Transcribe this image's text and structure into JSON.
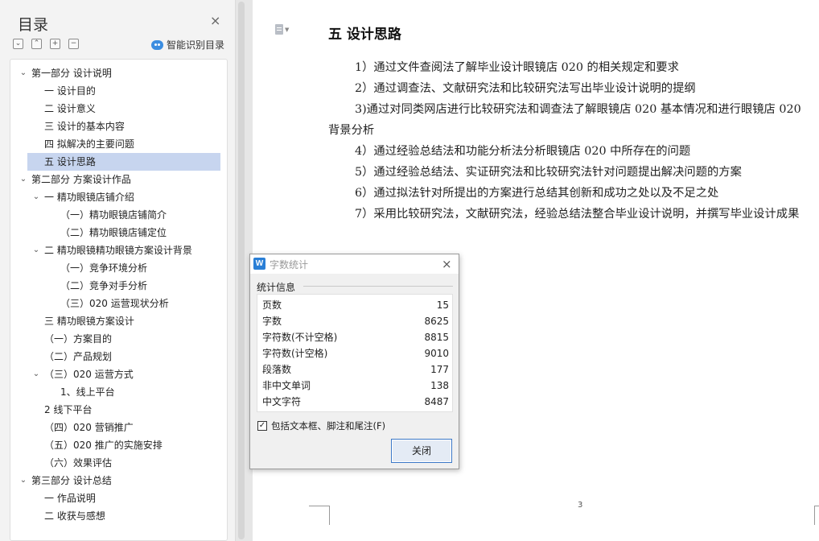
{
  "sidebar": {
    "title": "目录",
    "close_symbol": "×",
    "smart_label": "智能识别目录",
    "toc": [
      {
        "label": "第一部分  设计说明",
        "level": 0,
        "caret": "down",
        "selected": false
      },
      {
        "label": "一  设计目的",
        "level": 1,
        "caret": "",
        "selected": false
      },
      {
        "label": "二  设计意义",
        "level": 1,
        "caret": "",
        "selected": false
      },
      {
        "label": "三  设计的基本内容",
        "level": 1,
        "caret": "",
        "selected": false
      },
      {
        "label": "四  拟解决的主要问题",
        "level": 1,
        "caret": "",
        "selected": false
      },
      {
        "label": "五  设计思路",
        "level": 1,
        "caret": "",
        "selected": true
      },
      {
        "label": "第二部分  方案设计作品",
        "level": 0,
        "caret": "down",
        "selected": false
      },
      {
        "label": "一  精功眼镜店铺介绍",
        "level": 1,
        "caret": "down",
        "selected": false
      },
      {
        "label": "（一）精功眼镜店铺简介",
        "level": 2,
        "caret": "",
        "selected": false
      },
      {
        "label": "（二）精功眼镜店铺定位",
        "level": 2,
        "caret": "",
        "selected": false
      },
      {
        "label": "二  精功眼镜精功眼镜方案设计背景",
        "level": 1,
        "caret": "down",
        "selected": false
      },
      {
        "label": "（一）竞争环境分析",
        "level": 2,
        "caret": "",
        "selected": false
      },
      {
        "label": "（二）竞争对手分析",
        "level": 2,
        "caret": "",
        "selected": false
      },
      {
        "label": "（三）020 运营现状分析",
        "level": 2,
        "caret": "",
        "selected": false
      },
      {
        "label": "三  精功眼镜方案设计",
        "level": 1,
        "caret": "",
        "selected": false
      },
      {
        "label": "（一）方案目的",
        "level": 1,
        "caret": "",
        "selected": false
      },
      {
        "label": "（二）产品规划",
        "level": 1,
        "caret": "",
        "selected": false
      },
      {
        "label": "（三）020 运营方式",
        "level": 1,
        "caret": "down",
        "selected": false
      },
      {
        "label": "1、线上平台",
        "level": 2,
        "caret": "",
        "selected": false
      },
      {
        "label": "2 线下平台",
        "level": 1,
        "caret": "",
        "selected": false
      },
      {
        "label": "（四）020 营销推广",
        "level": 1,
        "caret": "",
        "selected": false
      },
      {
        "label": "（五）020 推广的实施安排",
        "level": 1,
        "caret": "",
        "selected": false
      },
      {
        "label": "（六）效果评估",
        "level": 1,
        "caret": "",
        "selected": false
      },
      {
        "label": "第三部分  设计总结",
        "level": 0,
        "caret": "down",
        "selected": false
      },
      {
        "label": "一  作品说明",
        "level": 1,
        "caret": "",
        "selected": false
      },
      {
        "label": "二  收获与感想",
        "level": 1,
        "caret": "",
        "selected": false
      }
    ]
  },
  "document": {
    "heading": "五  设计思路",
    "paragraphs": [
      "1）通过文件查阅法了解毕业设计眼镜店 020 的相关规定和要求",
      "2）通过调查法、文献研究法和比较研究法写出毕业设计说明的提纲",
      "3)通过对同类网店进行比较研究法和调查法了解眼镜店 020 基本情况和进行眼镜店 020 背景分析",
      "4）通过经验总结法和功能分析法分析眼镜店 020 中所存在的问题",
      "5）通过经验总结法、实证研究法和比较研究法针对问题提出解决问题的方案",
      "6）通过拟法针对所提出的方案进行总结其创新和成功之处以及不足之处",
      "7）采用比较研究法，文献研究法，经验总结法整合毕业设计说明，并撰写毕业设计成果"
    ],
    "page_number": "3"
  },
  "dialog": {
    "logo_letter": "W",
    "title": "字数统计",
    "close_symbol": "×",
    "group_label": "统计信息",
    "stats": [
      {
        "label": "页数",
        "value": "15"
      },
      {
        "label": "字数",
        "value": "8625"
      },
      {
        "label": "字符数(不计空格)",
        "value": "8815"
      },
      {
        "label": "字符数(计空格)",
        "value": "9010"
      },
      {
        "label": "段落数",
        "value": "177"
      },
      {
        "label": "非中文单词",
        "value": "138"
      },
      {
        "label": "中文字符",
        "value": "8487"
      }
    ],
    "checkbox_label": "包括文本框、脚注和尾注(F)",
    "checkbox_checked": true,
    "close_button": "关闭"
  },
  "colors": {
    "selected_toc": "#c7d5ef",
    "dialog_bg": "#f0f0f0",
    "button_border": "#3b78c8",
    "smart_icon": "#3b8de0"
  }
}
